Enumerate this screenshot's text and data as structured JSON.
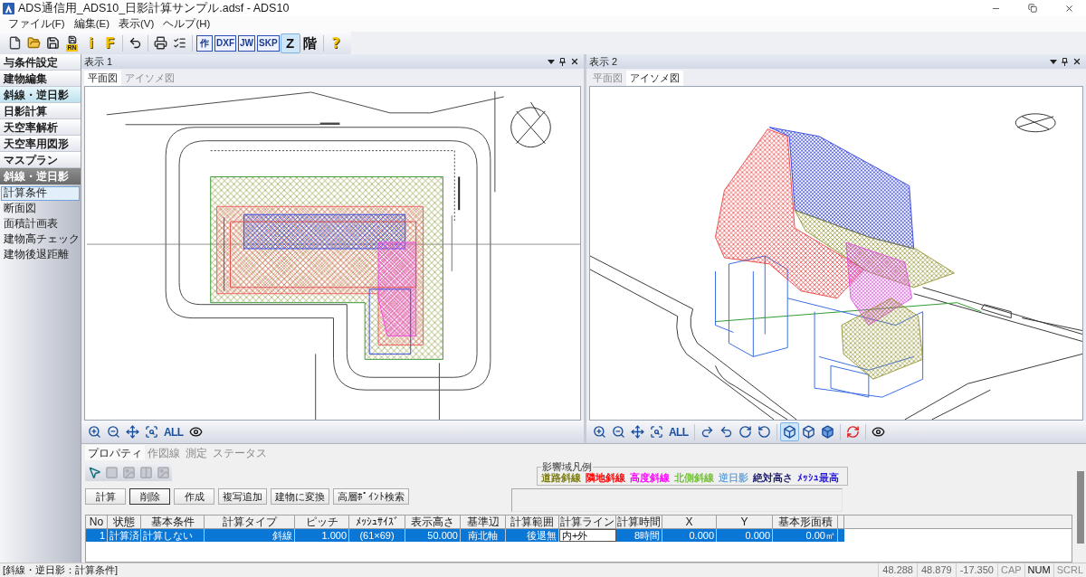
{
  "window": {
    "title": "ADS通信用_ADS10_日影計算サンプル.adsf - ADS10"
  },
  "menu": [
    {
      "label": "ファイル(F)"
    },
    {
      "label": "編集(E)"
    },
    {
      "label": "表示(V)"
    },
    {
      "label": "ヘルプ(H)"
    }
  ],
  "toolbar": [
    {
      "buttons": [
        {
          "kind": "new",
          "pressed": false
        },
        {
          "kind": "open",
          "pressed": false
        },
        {
          "kind": "save",
          "pressed": false
        },
        {
          "kind": "save-label",
          "label": "RN",
          "pressed": false
        },
        {
          "kind": "glyph",
          "label": "i",
          "pressed": false
        },
        {
          "kind": "glyph",
          "label": "F",
          "pressed": false
        }
      ]
    },
    {
      "buttons": [
        {
          "kind": "undo",
          "pressed": false
        }
      ]
    },
    {
      "buttons": [
        {
          "kind": "print",
          "pressed": false
        },
        {
          "kind": "list",
          "pressed": false
        }
      ]
    },
    {
      "buttons": [
        {
          "kind": "boxed",
          "label": "作",
          "pressed": false
        },
        {
          "kind": "boxed",
          "label": "DXF",
          "pressed": false
        },
        {
          "kind": "boxed",
          "label": "JW",
          "pressed": false
        },
        {
          "kind": "boxed",
          "label": "SKP",
          "pressed": false
        },
        {
          "kind": "plain",
          "label": "Z",
          "pressed": true
        },
        {
          "kind": "plain",
          "label": "階",
          "pressed": false
        }
      ]
    },
    {
      "buttons": [
        {
          "kind": "glyph",
          "label": "?",
          "pressed": false
        }
      ]
    }
  ],
  "sidebar": {
    "nav": [
      {
        "label": "与条件設定",
        "selected": false
      },
      {
        "label": "建物編集",
        "selected": false
      },
      {
        "label": "斜線・逆日影",
        "selected": true
      },
      {
        "label": "日影計算",
        "selected": false
      },
      {
        "label": "天空率解析",
        "selected": false
      },
      {
        "label": "天空率用図形",
        "selected": false
      },
      {
        "label": "マスプラン",
        "selected": false
      }
    ],
    "section": {
      "title": "斜線・逆日影",
      "items": [
        {
          "label": "計算条件",
          "selected": true
        },
        {
          "label": "断面図",
          "selected": false
        },
        {
          "label": "面積計画表",
          "selected": false
        },
        {
          "label": "建物高チェック",
          "selected": false
        },
        {
          "label": "建物後退距離",
          "selected": false
        }
      ]
    }
  },
  "views": [
    {
      "title": "表示 1",
      "tabs": [
        {
          "label": "平面図",
          "selected": true
        },
        {
          "label": "アイソメ図",
          "selected": false
        }
      ],
      "tools": [
        {
          "buttons": [
            {
              "kind": "zoom-in",
              "pressed": false
            },
            {
              "kind": "zoom-out",
              "pressed": false
            },
            {
              "kind": "pan",
              "pressed": false
            },
            {
              "kind": "zoom-window",
              "pressed": false
            },
            {
              "kind": "text",
              "label": "ALL",
              "pressed": false
            },
            {
              "kind": "eye",
              "pressed": false
            }
          ]
        }
      ]
    },
    {
      "title": "表示 2",
      "tabs": [
        {
          "label": "平面図",
          "selected": false
        },
        {
          "label": "アイソメ図",
          "selected": true
        }
      ],
      "tools": [
        {
          "buttons": [
            {
              "kind": "zoom-in",
              "pressed": false
            },
            {
              "kind": "zoom-out",
              "pressed": false
            },
            {
              "kind": "pan",
              "pressed": false
            },
            {
              "kind": "zoom-window",
              "pressed": false
            },
            {
              "kind": "text",
              "label": "ALL",
              "pressed": false
            }
          ]
        },
        {
          "buttons": [
            {
              "kind": "rotate-right",
              "pressed": false
            },
            {
              "kind": "rotate-left",
              "pressed": false
            },
            {
              "kind": "rotate-up",
              "pressed": false
            },
            {
              "kind": "rotate-down",
              "pressed": false
            }
          ]
        },
        {
          "buttons": [
            {
              "kind": "cube-wire",
              "pressed": true
            },
            {
              "kind": "cube-outline",
              "pressed": false
            },
            {
              "kind": "cube-solid",
              "pressed": false
            }
          ]
        },
        {
          "buttons": [
            {
              "kind": "orbit",
              "pressed": false
            }
          ]
        },
        {
          "buttons": [
            {
              "kind": "eye",
              "pressed": false
            }
          ]
        }
      ]
    }
  ],
  "properties": {
    "tabs": [
      {
        "label": "プロパティ",
        "selected": true
      },
      {
        "label": "作図線",
        "selected": false
      },
      {
        "label": "測定",
        "selected": false
      },
      {
        "label": "ステータス",
        "selected": false
      }
    ],
    "tools": [
      {
        "kind": "pointer",
        "disabled": false
      },
      {
        "kind": "square",
        "disabled": true
      },
      {
        "kind": "picture",
        "disabled": true
      },
      {
        "kind": "split",
        "disabled": true
      },
      {
        "kind": "picture",
        "disabled": true
      }
    ],
    "buttons": [
      {
        "label": "計算",
        "focused": false
      },
      {
        "label": "削除",
        "focused": true
      },
      {
        "label": "作成",
        "focused": false
      },
      {
        "label": "複写追加",
        "focused": false
      },
      {
        "label": "建物に変換",
        "focused": false
      },
      {
        "label": "高層ﾎﾟｲﾝﾄ検索",
        "focused": false
      }
    ],
    "legend": {
      "title": "影響域凡例",
      "items": [
        {
          "label": "道路斜線",
          "color": "#7a7a10"
        },
        {
          "label": "隣地斜線",
          "color": "#ff0000"
        },
        {
          "label": "高度斜線",
          "color": "#ff00ff"
        },
        {
          "label": "北側斜線",
          "color": "#70c030"
        },
        {
          "label": "逆日影",
          "color": "#6aa4dc"
        },
        {
          "label": "絶対高さ",
          "color": "#1a1a70"
        },
        {
          "label": "ﾒｯｼｭ最高",
          "color": "#2a1ee0"
        }
      ]
    },
    "table": {
      "columns": [
        "No",
        "状態",
        "基本条件",
        "計算タイプ",
        "ピッチ",
        "ﾒｯｼｭｻｲｽﾞ",
        "表示高さ",
        "基準辺",
        "計算範囲",
        "計算ライン",
        "計算時間",
        "X",
        "Y",
        "基本形面積"
      ],
      "rows": [
        {
          "selected": true,
          "cells": [
            {
              "text": "1",
              "editing": false
            },
            {
              "text": "計算済",
              "editing": false
            },
            {
              "text": "計算しない",
              "editing": false
            },
            {
              "text": "斜線",
              "editing": false
            },
            {
              "text": "1.000",
              "editing": false
            },
            {
              "text": "(61×69)",
              "editing": false
            },
            {
              "text": "50.000",
              "editing": false
            },
            {
              "text": "南北軸",
              "editing": false
            },
            {
              "text": "後退無",
              "editing": false
            },
            {
              "text": "内+外",
              "editing": true
            },
            {
              "text": "8時間",
              "editing": false
            },
            {
              "text": "0.000",
              "editing": false
            },
            {
              "text": "0.000",
              "editing": false
            },
            {
              "text": "0.00㎡",
              "editing": false
            }
          ]
        }
      ]
    }
  },
  "status_bar": {
    "text": "[斜線・逆日影：計算条件]",
    "readouts": [
      "48.288",
      "48.879",
      "-17.350"
    ],
    "indicators": [
      {
        "label": "CAP",
        "on": false
      },
      {
        "label": "NUM",
        "on": true
      },
      {
        "label": "SCRL",
        "on": false
      }
    ]
  }
}
